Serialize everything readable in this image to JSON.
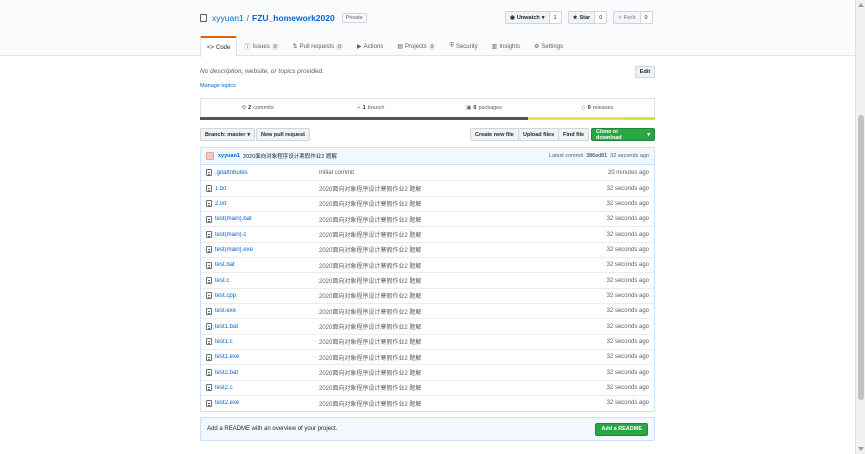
{
  "repo": {
    "owner": "xyyuan1",
    "separator": "/",
    "name": "FZU_homework2020",
    "visibility": "Private"
  },
  "actions": [
    {
      "label": "Unwatch",
      "count": "1",
      "icon": "eye-icon"
    },
    {
      "label": "Star",
      "count": "0",
      "icon": "star-icon"
    },
    {
      "label": "Fork",
      "count": "0",
      "icon": "fork-icon"
    }
  ],
  "tabs": [
    {
      "label": "Code",
      "count": "",
      "icon": "code-icon"
    },
    {
      "label": "Issues",
      "count": "0",
      "icon": "issue-icon"
    },
    {
      "label": "Pull requests",
      "count": "0",
      "icon": "pull-request-icon"
    },
    {
      "label": "Actions",
      "count": "",
      "icon": "play-icon"
    },
    {
      "label": "Projects",
      "count": "0",
      "icon": "project-icon"
    },
    {
      "label": "Security",
      "count": "",
      "icon": "shield-icon"
    },
    {
      "label": "Insights",
      "count": "",
      "icon": "graph-icon"
    },
    {
      "label": "Settings",
      "count": "",
      "icon": "gear-icon"
    }
  ],
  "about": {
    "description": "No description, website, or topics provided.",
    "manage_topics": "Manage topics",
    "edit": "Edit"
  },
  "summary": {
    "commits_count": "2",
    "commits_label": "commits",
    "branches_count": "1",
    "branches_label": "branch",
    "packages_count": "0",
    "packages_label": "packages",
    "releases_count": "0",
    "releases_label": "releases"
  },
  "language_colors": [
    "#555555",
    "#f1e05a",
    "#ee6d8a",
    "#c1f12e"
  ],
  "file_nav": {
    "branch": "Branch: master",
    "new_pr": "New pull request",
    "create_file": "Create new file",
    "upload": "Upload files",
    "find": "Find file",
    "clone": "Clone or download"
  },
  "latest_commit": {
    "author": "xyyuan1",
    "message": "2020面向对象程序设计寒假作业2 题解",
    "label": "Latest commit",
    "sha": "386ed81",
    "age": "32 seconds ago"
  },
  "files": [
    {
      "name": ".gitattributes",
      "message": "Initial commit",
      "age": "20 minutes ago"
    },
    {
      "name": "1.txt",
      "message": "2020面向对象程序设计寒假作业2 题解",
      "age": "32 seconds ago"
    },
    {
      "name": "2.txt",
      "message": "2020面向对象程序设计寒假作业2 题解",
      "age": "32 seconds ago"
    },
    {
      "name": "test(main).bat",
      "message": "2020面向对象程序设计寒假作业2 题解",
      "age": "32 seconds ago"
    },
    {
      "name": "test(main).c",
      "message": "2020面向对象程序设计寒假作业2 题解",
      "age": "32 seconds ago"
    },
    {
      "name": "test(main).exe",
      "message": "2020面向对象程序设计寒假作业2 题解",
      "age": "32 seconds ago"
    },
    {
      "name": "test.bat",
      "message": "2020面向对象程序设计寒假作业2 题解",
      "age": "32 seconds ago"
    },
    {
      "name": "test.c",
      "message": "2020面向对象程序设计寒假作业2 题解",
      "age": "32 seconds ago"
    },
    {
      "name": "test.cpp",
      "message": "2020面向对象程序设计寒假作业2 题解",
      "age": "32 seconds ago"
    },
    {
      "name": "test.exe",
      "message": "2020面向对象程序设计寒假作业2 题解",
      "age": "32 seconds ago"
    },
    {
      "name": "test1.bat",
      "message": "2020面向对象程序设计寒假作业2 题解",
      "age": "32 seconds ago"
    },
    {
      "name": "test1.c",
      "message": "2020面向对象程序设计寒假作业2 题解",
      "age": "32 seconds ago"
    },
    {
      "name": "test1.exe",
      "message": "2020面向对象程序设计寒假作业2 题解",
      "age": "32 seconds ago"
    },
    {
      "name": "test2.bat",
      "message": "2020面向对象程序设计寒假作业2 题解",
      "age": "32 seconds ago"
    },
    {
      "name": "test2.c",
      "message": "2020面向对象程序设计寒假作业2 题解",
      "age": "32 seconds ago"
    },
    {
      "name": "test2.exe",
      "message": "2020面向对象程序设计寒假作业2 题解",
      "age": "32 seconds ago"
    }
  ],
  "readme": {
    "text": "Add a README with an overview of your project.",
    "button": "Add a README"
  }
}
